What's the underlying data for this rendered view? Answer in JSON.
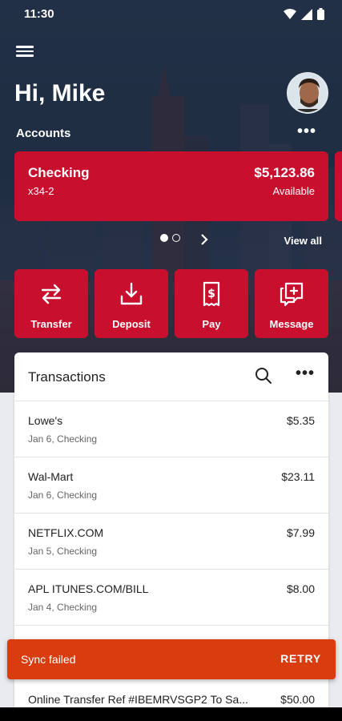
{
  "status_bar": {
    "time": "11:30"
  },
  "header": {
    "greeting": "Hi, Mike",
    "accounts_label": "Accounts",
    "accounts_more": "•••"
  },
  "account": {
    "name": "Checking",
    "number": "x34-2",
    "balance": "$5,123.86",
    "balance_label": "Available"
  },
  "pager": {
    "view_all": "View all",
    "pages": 2,
    "active_index": 0
  },
  "actions": [
    {
      "label": "Transfer",
      "icon": "transfer-icon"
    },
    {
      "label": "Deposit",
      "icon": "deposit-icon"
    },
    {
      "label": "Pay",
      "icon": "pay-icon"
    },
    {
      "label": "Message",
      "icon": "message-icon"
    }
  ],
  "transactions": {
    "title": "Transactions",
    "more": "•••",
    "items": [
      {
        "name": "Lowe's",
        "meta": "Jan 6, Checking",
        "amount": "$5.35"
      },
      {
        "name": "Wal-Mart",
        "meta": "Jan 6, Checking",
        "amount": "$23.11"
      },
      {
        "name": "NETFLIX.COM",
        "meta": "Jan 5, Checking",
        "amount": "$7.99"
      },
      {
        "name": "APL ITUNES.COM/BILL",
        "meta": "Jan 4, Checking",
        "amount": "$8.00"
      }
    ],
    "partial_item": {
      "name": "Online Transfer Ref #IBEMRVSGP2 To Sa...",
      "amount": "$50.00"
    }
  },
  "snackbar": {
    "message": "Sync failed",
    "action": "RETRY"
  },
  "colors": {
    "brand_red": "#c8102e",
    "snackbar": "#d93d0f",
    "hero_bg": "#223047"
  }
}
